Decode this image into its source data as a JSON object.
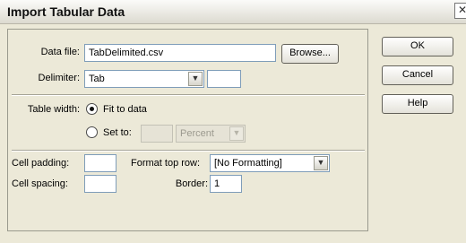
{
  "window": {
    "title": "Import Tabular Data",
    "close_glyph": "✕"
  },
  "form": {
    "data_file": {
      "label": "Data file:",
      "value": "TabDelimited.csv",
      "browse_label": "Browse..."
    },
    "delimiter": {
      "label": "Delimiter:",
      "selected": "Tab",
      "other_value": ""
    },
    "table_width": {
      "label": "Table width:",
      "fit_option": "Fit to data",
      "set_option": "Set to:",
      "set_value": "",
      "unit_selected": "Percent",
      "selected_option": "fit"
    },
    "cell_padding": {
      "label": "Cell padding:",
      "value": ""
    },
    "cell_spacing": {
      "label": "Cell spacing:",
      "value": ""
    },
    "format_top_row": {
      "label": "Format top row:",
      "selected": "[No Formatting]"
    },
    "border": {
      "label": "Border:",
      "value": "1"
    }
  },
  "buttons": {
    "ok": "OK",
    "cancel": "Cancel",
    "help": "Help"
  },
  "icons": {
    "dropdown": "▼"
  }
}
